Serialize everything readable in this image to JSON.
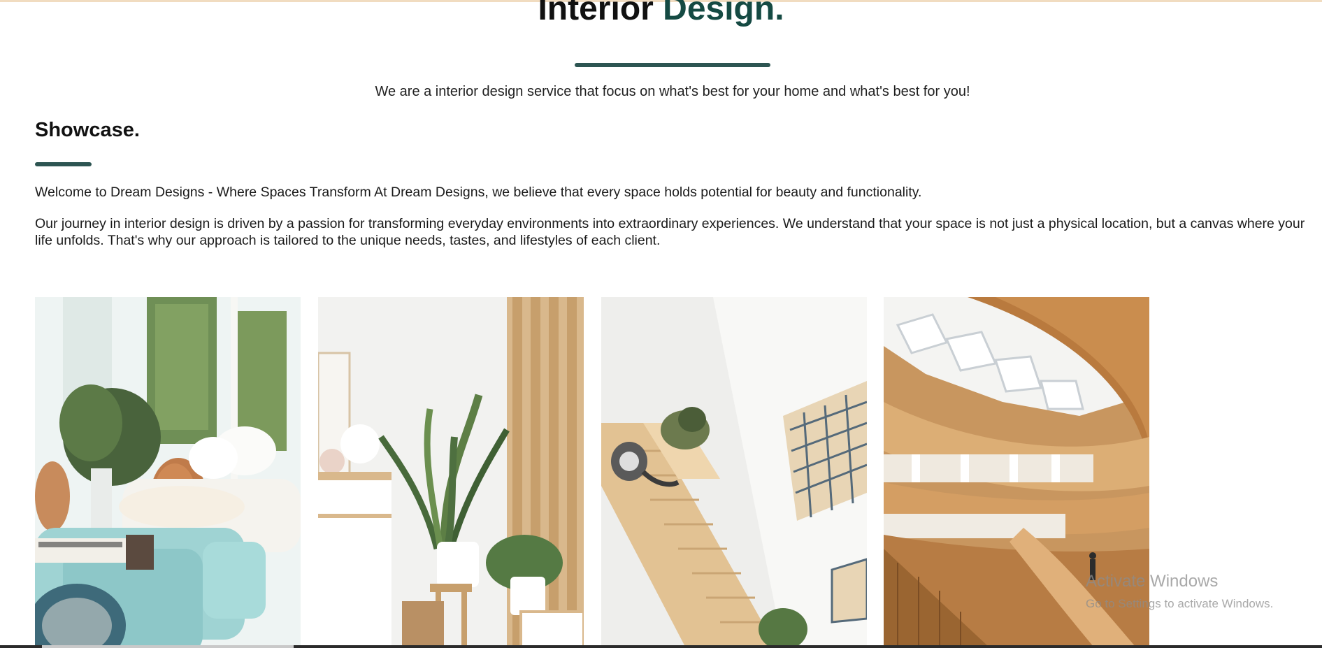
{
  "hero": {
    "title_main": "Interior ",
    "title_accent": "Design."
  },
  "intro": {
    "tagline": "We are a interior design service that focus on what's best for your home and what's best for you!"
  },
  "showcase": {
    "heading": "Showcase.",
    "paragraph_1": "Welcome to Dream Designs - Where Spaces Transform At Dream Designs, we believe that every space holds potential for beauty and functionality.",
    "paragraph_2": "Our journey in interior design is driven by a passion for transforming everyday environments into extraordinary experiences. We understand that your space is not just a physical location, but a canvas where your life unfolds. That's why our approach is tailored to the unique needs, tastes, and lifestyles of each client."
  },
  "gallery": {
    "images": [
      {
        "name": "living-room-photo"
      },
      {
        "name": "plant-corner-photo"
      },
      {
        "name": "staircase-cat-photo"
      },
      {
        "name": "library-atrium-photo"
      }
    ]
  },
  "system_overlay": {
    "title": "Activate Windows",
    "subtitle": "Go to Settings to activate Windows."
  },
  "colors": {
    "accent_green": "#154a43",
    "rule_color": "#2d5552"
  }
}
